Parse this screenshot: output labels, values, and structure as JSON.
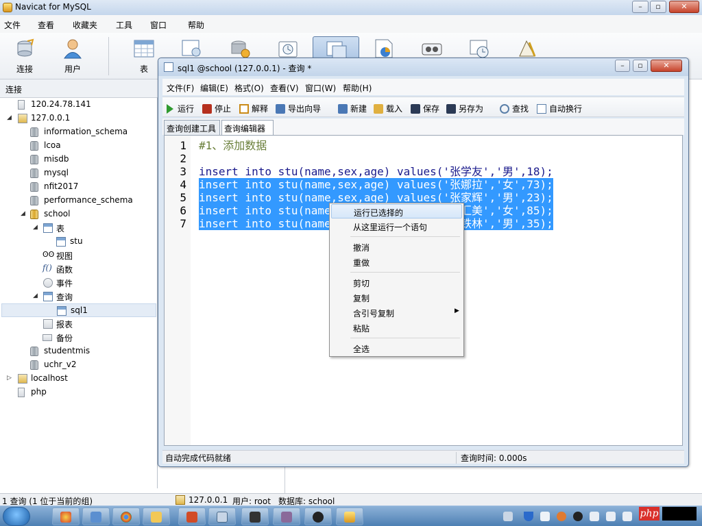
{
  "app": {
    "title": "Navicat for MySQL"
  },
  "menu": [
    "文件",
    "查看",
    "收藏夹",
    "工具",
    "窗口",
    "帮助"
  ],
  "toolbar": [
    {
      "label": "连接",
      "icon": "connection-icon"
    },
    {
      "label": "用户",
      "icon": "user-icon"
    },
    {
      "label": "表",
      "icon": "table-icon"
    },
    {
      "label": "",
      "icon": "view-icon"
    },
    {
      "label": "",
      "icon": "function-icon"
    },
    {
      "label": "",
      "icon": "event-icon"
    },
    {
      "label": "",
      "icon": "query-icon"
    },
    {
      "label": "",
      "icon": "report-icon"
    },
    {
      "label": "",
      "icon": "backup-icon"
    },
    {
      "label": "",
      "icon": "schedule-icon"
    },
    {
      "label": "",
      "icon": "model-icon"
    }
  ],
  "connection_panel": {
    "header": "连接"
  },
  "tree": [
    {
      "label": "120.24.78.141",
      "level": 0,
      "icon": "server-icon"
    },
    {
      "label": "127.0.0.1",
      "level": 0,
      "icon": "server-open-icon",
      "expanded": true
    },
    {
      "label": "information_schema",
      "level": 1,
      "icon": "database-icon"
    },
    {
      "label": "lcoa",
      "level": 1,
      "icon": "database-icon"
    },
    {
      "label": "misdb",
      "level": 1,
      "icon": "database-icon"
    },
    {
      "label": "mysql",
      "level": 1,
      "icon": "database-icon"
    },
    {
      "label": "nfit2017",
      "level": 1,
      "icon": "database-icon"
    },
    {
      "label": "performance_schema",
      "level": 1,
      "icon": "database-icon"
    },
    {
      "label": "school",
      "level": 1,
      "icon": "database-open-icon",
      "expanded": true
    },
    {
      "label": "表",
      "level": 2,
      "icon": "tables-icon",
      "expanded": true
    },
    {
      "label": "stu",
      "level": 3,
      "icon": "table-icon"
    },
    {
      "label": "视图",
      "level": 2,
      "icon": "view-icon"
    },
    {
      "label": "函数",
      "level": 2,
      "icon": "function-icon"
    },
    {
      "label": "事件",
      "level": 2,
      "icon": "event-icon"
    },
    {
      "label": "查询",
      "level": 2,
      "icon": "query-icon",
      "expanded": true
    },
    {
      "label": "sql1",
      "level": 3,
      "icon": "query-item-icon",
      "selected": true
    },
    {
      "label": "报表",
      "level": 2,
      "icon": "report-icon"
    },
    {
      "label": "备份",
      "level": 2,
      "icon": "backup-icon"
    },
    {
      "label": "studentmis",
      "level": 1,
      "icon": "database-icon"
    },
    {
      "label": "uchr_v2",
      "level": 1,
      "icon": "database-icon"
    },
    {
      "label": "localhost",
      "level": 0,
      "icon": "server-icon"
    },
    {
      "label": "php",
      "level": 0,
      "icon": "server-icon"
    }
  ],
  "statusbar": {
    "left": "1 查询 (1 位于当前的组)",
    "server": "127.0.0.1",
    "user": "用户: root",
    "database": "数据库: school"
  },
  "query_window": {
    "title": "sql1 @school (127.0.0.1) - 查询 *",
    "menu": [
      "文件(F)",
      "编辑(E)",
      "格式(O)",
      "查看(V)",
      "窗口(W)",
      "帮助(H)"
    ],
    "tools": [
      {
        "label": "运行",
        "icon": "run-icon",
        "color": "#2f9a2f"
      },
      {
        "label": "停止",
        "icon": "stop-icon",
        "color": "#b5301e"
      },
      {
        "label": "解释",
        "icon": "explain-icon",
        "color": "#c98a17"
      },
      {
        "label": "导出向导",
        "icon": "export-icon",
        "color": "#4a78b5"
      },
      {
        "label": "新建",
        "icon": "new-icon",
        "color": "#4a78b5"
      },
      {
        "label": "载入",
        "icon": "load-icon",
        "color": "#e0b040"
      },
      {
        "label": "保存",
        "icon": "save-icon",
        "color": "#2b3a55"
      },
      {
        "label": "另存为",
        "icon": "save-as-icon",
        "color": "#2b3a55"
      },
      {
        "label": "查找",
        "icon": "find-icon",
        "color": "#5a7fa8"
      },
      {
        "label": "自动换行",
        "icon": "wrap-icon",
        "color": "#5a7fa8"
      }
    ],
    "tabs": [
      "查询创建工具",
      "查询编辑器"
    ],
    "active_tab": "查询编辑器",
    "lines": [
      {
        "n": "1",
        "text": "#1、添加数据"
      },
      {
        "n": "2",
        "text": ""
      },
      {
        "n": "3",
        "text": "insert into stu(name,sex,age) values('张学友','男',18);"
      },
      {
        "n": "4",
        "text": "insert into stu(name,sex,age) values('张娜拉','女',73);"
      },
      {
        "n": "5",
        "text": "insert into stu(name,sex,age) values('张家辉','男',23);"
      },
      {
        "n": "6",
        "text": "insert into stu(name,sex,age) values('张汇美','女',85);"
      },
      {
        "n": "7",
        "text": "insert into stu(name,sex,age) values('张铁林','男',35);"
      }
    ],
    "status_left": "自动完成代码就绪",
    "status_right": "查询时间: 0.000s"
  },
  "context_menu": [
    {
      "label": "运行已选择的",
      "highlighted": true
    },
    {
      "label": "从这里运行一个语句"
    },
    {
      "sep": true
    },
    {
      "label": "撤消"
    },
    {
      "label": "重做"
    },
    {
      "sep": true
    },
    {
      "label": "剪切"
    },
    {
      "label": "复制"
    },
    {
      "label": "含引号复制",
      "submenu": true
    },
    {
      "label": "粘贴"
    },
    {
      "sep": true
    },
    {
      "label": "全选"
    }
  ],
  "taskbar": {
    "badge": "php"
  },
  "colors": {
    "selection": "#3399ff",
    "accent": "#5a7597"
  }
}
